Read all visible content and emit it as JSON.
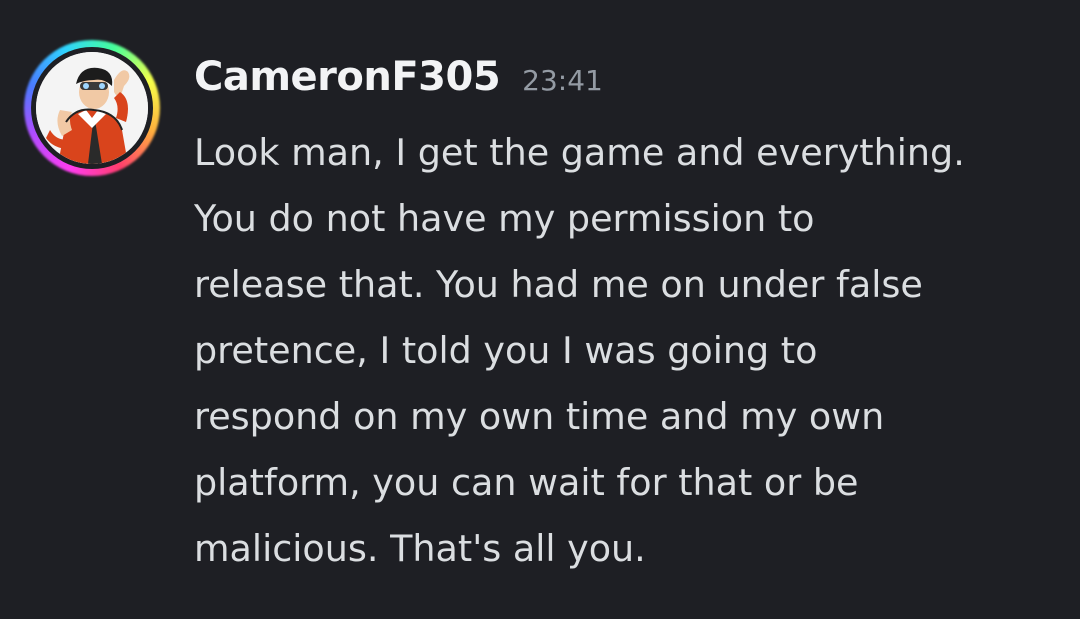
{
  "message": {
    "author": "CameronF305",
    "timestamp": "23:41",
    "lines": [
      "Look man, I get the game and everything.",
      "You do not have my permission to",
      "release that. You had me on under false",
      "pretence, I told you I was going to",
      "respond on my own time and my own",
      "platform, you can wait for that or be",
      "malicious. That's all you."
    ]
  },
  "colors": {
    "background": "#1e1f24",
    "username": "#f2f3f5",
    "timestamp": "#949ba4",
    "text": "#dbdee1"
  },
  "icons": {
    "avatar": "avatar-with-rainbow-decoration"
  }
}
